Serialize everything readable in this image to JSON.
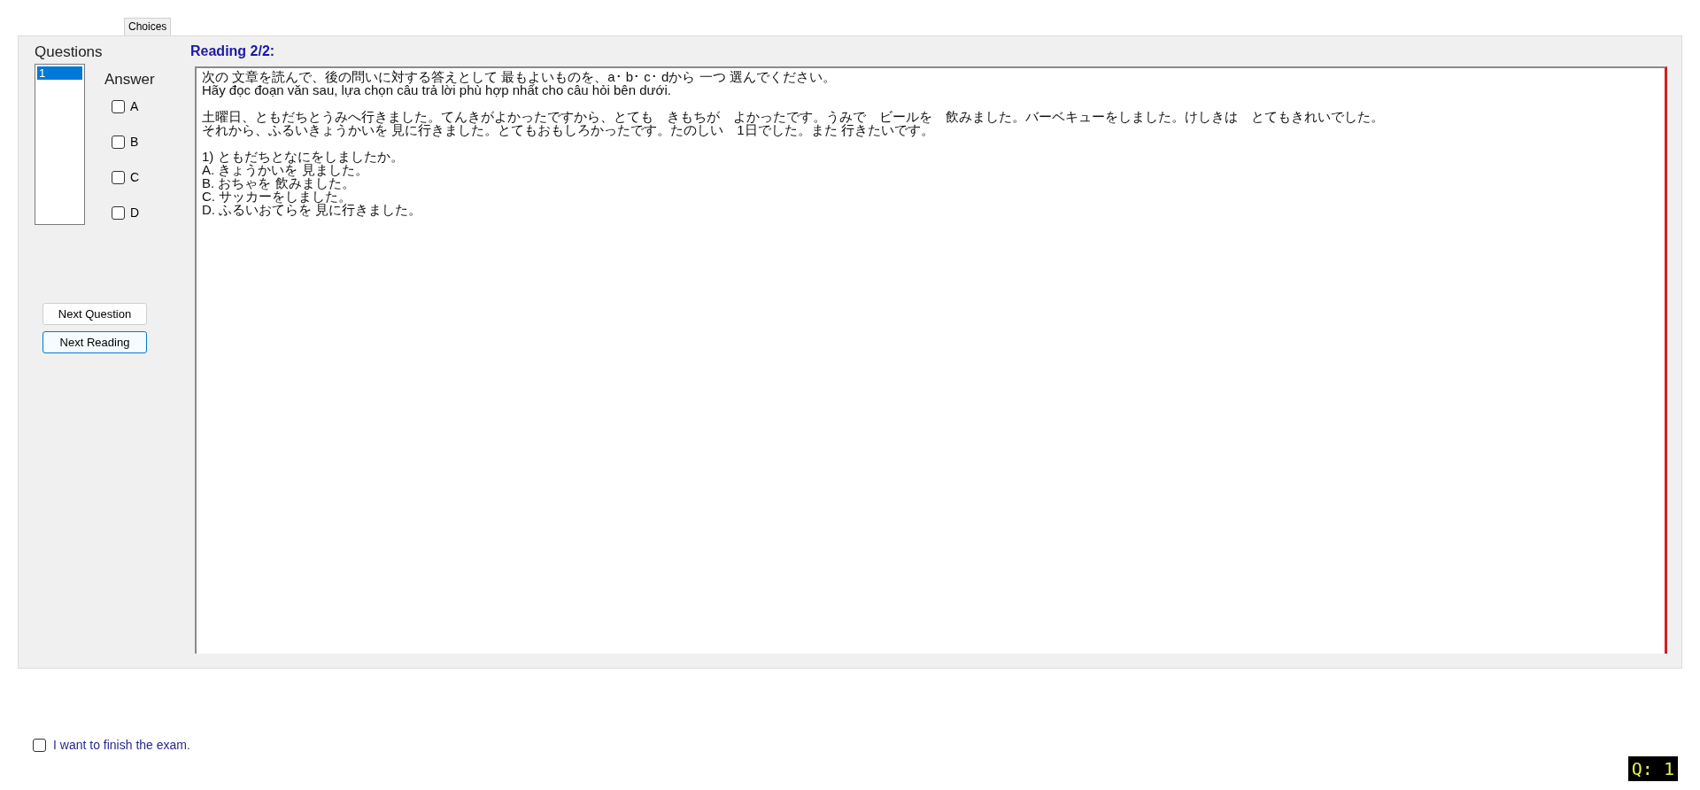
{
  "tabs": [
    {
      "label": "Choices",
      "selected": true
    }
  ],
  "questions": {
    "title": "Questions",
    "items": [
      {
        "label": "1",
        "selected": true
      }
    ]
  },
  "answer": {
    "title": "Answer",
    "options": [
      {
        "label": "A",
        "checked": false
      },
      {
        "label": "B",
        "checked": false
      },
      {
        "label": "C",
        "checked": false
      },
      {
        "label": "D",
        "checked": false
      }
    ]
  },
  "buttons": [
    {
      "label": "Next Question",
      "focused": false
    },
    {
      "label": "Next Reading",
      "focused": true
    }
  ],
  "reading": {
    "title": "Reading 2/2:",
    "paragraphs": [
      [
        "次の 文章を読んで、後の問いに対する答えとして 最もよいものを、a･ b･ c･ dから 一つ 選んでください。",
        "Hãy đọc đoạn văn sau, lựa chọn câu trả lời phù hợp nhất cho câu hỏi bên dưới."
      ],
      [
        "土曜日、ともだちとうみへ行きました。てんきがよかったですから、とても　きもちが　よかったです。うみで　ビールを　飲みました。バーベキューをしました。けしきは　とてもきれいでした。",
        "それから、ふるいきょうかいを 見に行きました。とてもおもしろかったです。たのしい　1日でした。また 行きたいです。"
      ],
      [
        "1) ともだちとなにをしましたか。",
        "A.  きょうかいを 見ました。",
        "B.  おちゃを 飲みました。",
        "C.  サッカーをしました。",
        "D.  ふるいおてらを 見に行きました。"
      ]
    ]
  },
  "finish": {
    "label": "I want to finish the exam.",
    "checked": false
  },
  "badge": "Q: 1"
}
